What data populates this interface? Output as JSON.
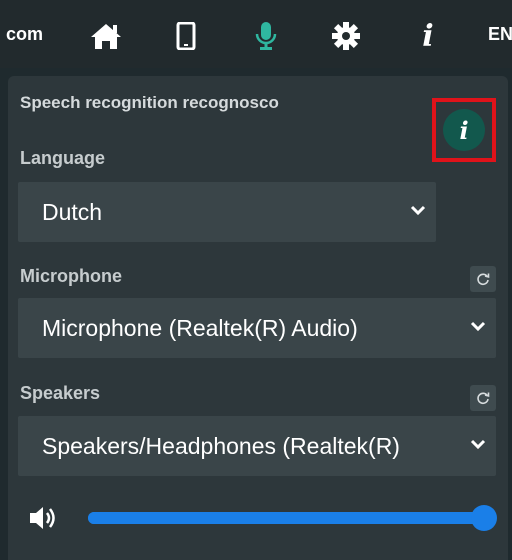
{
  "nav": {
    "host_fragment": "com",
    "language_code": "EN",
    "icons": [
      "home-icon",
      "phone-icon",
      "microphone-icon",
      "gear-icon",
      "info-icon"
    ],
    "mic_color": "#2fb7a0"
  },
  "panel": {
    "title": "Speech recognition recognosco",
    "language": {
      "label": "Language",
      "value": "Dutch"
    },
    "info_button": {
      "glyph": "i"
    },
    "microphone": {
      "label": "Microphone",
      "value": "Microphone (Realtek(R) Audio)"
    },
    "speakers": {
      "label": "Speakers",
      "value": "Speakers/Headphones (Realtek(R)"
    },
    "volume": {
      "level": 1.0
    }
  },
  "colors": {
    "accent": "#1a7fe8",
    "highlight_border": "#e0131a",
    "info_button": "#12584d"
  }
}
